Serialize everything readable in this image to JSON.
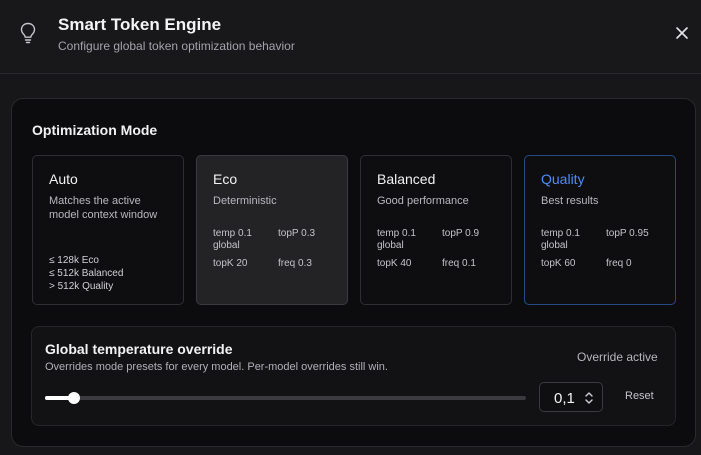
{
  "header": {
    "icon": "lightbulb-icon",
    "title": "Smart Token Engine",
    "subtitle": "Configure global token optimization behavior",
    "close_icon": "close-icon"
  },
  "optimization": {
    "section_title": "Optimization Mode",
    "selected": "Quality",
    "accent_color": "#4b8df8",
    "modes": [
      {
        "name": "Auto",
        "description": "Matches the active model context window",
        "thresholds": [
          "≤ 128k Eco",
          "≤ 512k Balanced",
          "> 512k Quality"
        ]
      },
      {
        "name": "Eco",
        "description": "Deterministic",
        "temp": "temp 0.1",
        "scope": "global",
        "topP": "topP 0.3",
        "topK": "topK 20",
        "freq": "freq 0.3"
      },
      {
        "name": "Balanced",
        "description": "Good performance",
        "temp": "temp 0.1",
        "scope": "global",
        "topP": "topP 0.9",
        "topK": "topK 40",
        "freq": "freq 0.1"
      },
      {
        "name": "Quality",
        "description": "Best results",
        "temp": "temp 0.1",
        "scope": "global",
        "topP": "topP 0.95",
        "topK": "topK 60",
        "freq": "freq 0"
      }
    ]
  },
  "temperature_override": {
    "title": "Global temperature override",
    "description": "Overrides mode presets for every model. Per-model overrides still win.",
    "status": "Override active",
    "slider_fraction": 0.06,
    "value": "0,1",
    "stepper_icon": "chevron-up-down-icon",
    "reset_label": "Reset"
  }
}
